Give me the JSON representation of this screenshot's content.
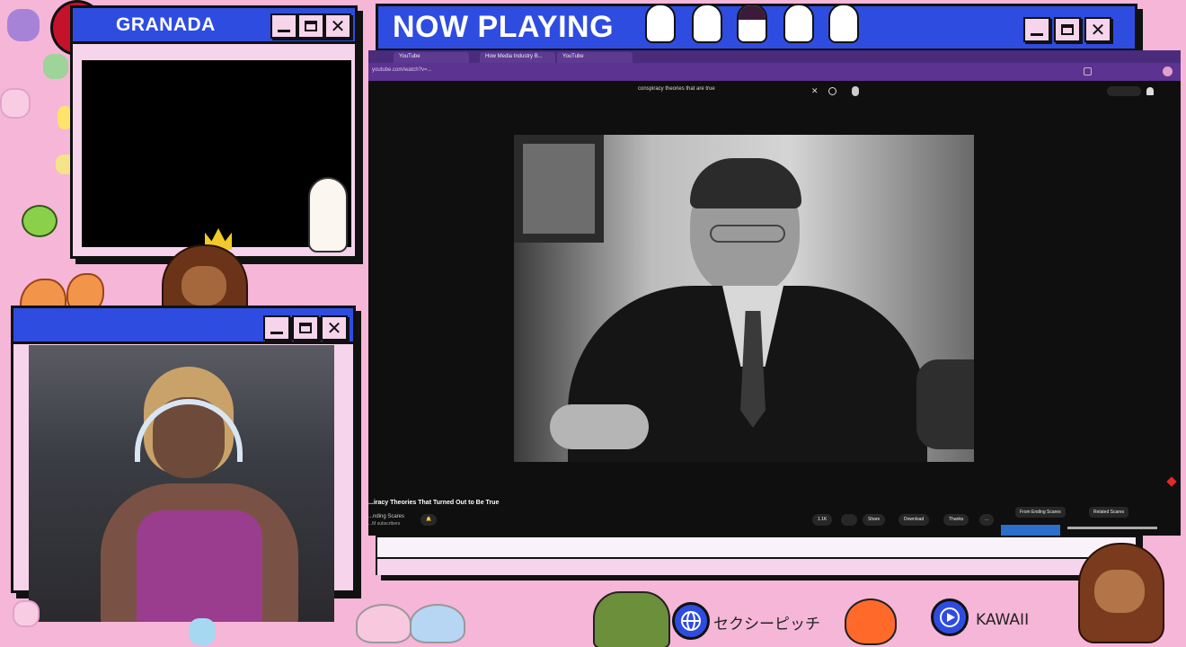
{
  "granada_window": {
    "title": "GRANADA",
    "controls": {
      "minimize": "minimize",
      "maximize": "maximize",
      "close": "close"
    }
  },
  "now_playing_window": {
    "title": "NOW PLAYING"
  },
  "browser": {
    "tabs": [
      "YouTube",
      "How Media Industry B...",
      "YouTube"
    ],
    "address": "youtube.com/watch?v=...",
    "search_query": "conspiracy theories that are true"
  },
  "video": {
    "title": "...iracy Theories That Turned Out to Be True",
    "channel": "...nding Scares",
    "subscribers": "...M subscribers",
    "actions": [
      "1.1K",
      "",
      "Share",
      "Download",
      "Thanks",
      "..."
    ],
    "chips": [
      "From Ending Scares",
      "Related Scares"
    ]
  },
  "bottom_bar": {
    "link1_label": "セクシーピッチ",
    "link2_label": "KAWAII"
  },
  "icons": [
    "globe-icon",
    "play-icon",
    "search-icon",
    "mic-icon",
    "bell-icon"
  ],
  "colors": {
    "background": "#f6b6d8",
    "window_blue": "#2f4ce0",
    "window_pink": "#f6d4ec",
    "browser_purple": "#5c3391"
  }
}
